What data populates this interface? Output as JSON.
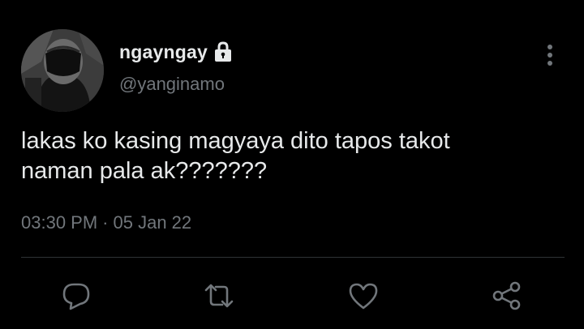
{
  "tweet": {
    "display_name": "ngayngay",
    "handle": "@yanginamo",
    "text": "lakas ko kasing magyaya dito tapos takot\nnaman pala ak???????",
    "time": "03:30 PM",
    "separator": "·",
    "date": "05 Jan 22",
    "protected_icon": "lock-icon"
  },
  "actions": [
    {
      "name": "reply",
      "icon": "reply-icon"
    },
    {
      "name": "retweet",
      "icon": "retweet-icon"
    },
    {
      "name": "like",
      "icon": "heart-icon"
    },
    {
      "name": "share",
      "icon": "share-icon"
    }
  ],
  "colors": {
    "background": "#000000",
    "primary_text": "#e7e9ea",
    "secondary_text": "#71767b",
    "divider": "#2f3336"
  }
}
